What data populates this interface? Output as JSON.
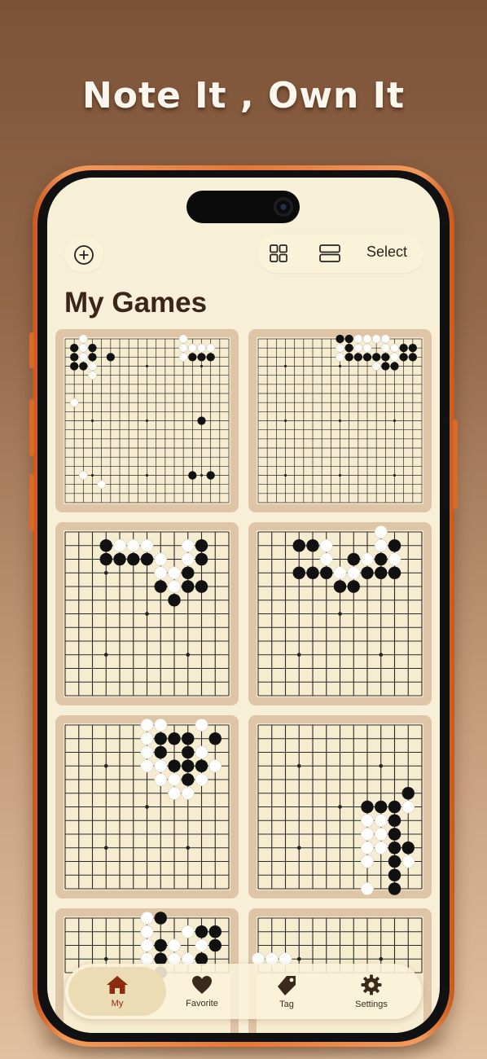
{
  "promo": {
    "headline": "Note It , Own It"
  },
  "header": {
    "add_icon": "plus-circle-icon",
    "grid_view_icon": "grid-view-icon",
    "list_view_icon": "list-view-icon",
    "select_label": "Select"
  },
  "page": {
    "title": "My Games"
  },
  "games": [
    {
      "size": 19,
      "view_rows": 19,
      "view_cols": 19,
      "col_offset": 0,
      "row_offset": 0,
      "hoshi": [
        [
          3,
          3
        ],
        [
          3,
          9
        ],
        [
          3,
          15
        ],
        [
          9,
          3
        ],
        [
          9,
          9
        ],
        [
          9,
          15
        ],
        [
          15,
          3
        ],
        [
          15,
          9
        ],
        [
          15,
          15
        ]
      ],
      "black": [
        [
          1,
          1
        ],
        [
          2,
          1
        ],
        [
          3,
          1
        ],
        [
          1,
          3
        ],
        [
          2,
          3
        ],
        [
          3,
          2
        ],
        [
          2,
          5
        ],
        [
          1,
          14
        ],
        [
          2,
          14
        ],
        [
          2,
          15
        ],
        [
          2,
          16
        ],
        [
          9,
          15
        ],
        [
          15,
          14
        ],
        [
          15,
          16
        ]
      ],
      "white": [
        [
          0,
          2
        ],
        [
          1,
          2
        ],
        [
          2,
          2
        ],
        [
          3,
          3
        ],
        [
          4,
          3
        ],
        [
          1,
          14
        ],
        [
          2,
          13
        ],
        [
          1,
          15
        ],
        [
          1,
          16
        ],
        [
          7,
          1
        ],
        [
          15,
          2
        ],
        [
          16,
          4
        ],
        [
          0,
          13
        ],
        [
          1,
          13
        ]
      ]
    },
    {
      "size": 19,
      "view_rows": 19,
      "view_cols": 19,
      "col_offset": 0,
      "row_offset": 0,
      "hoshi": [
        [
          3,
          3
        ],
        [
          3,
          9
        ],
        [
          3,
          15
        ],
        [
          9,
          3
        ],
        [
          9,
          9
        ],
        [
          9,
          15
        ],
        [
          15,
          3
        ],
        [
          15,
          9
        ],
        [
          15,
          15
        ]
      ],
      "black": [
        [
          0,
          9
        ],
        [
          0,
          10
        ],
        [
          1,
          10
        ],
        [
          2,
          10
        ],
        [
          2,
          11
        ],
        [
          2,
          12
        ],
        [
          2,
          13
        ],
        [
          2,
          14
        ],
        [
          3,
          14
        ],
        [
          3,
          15
        ],
        [
          1,
          16
        ],
        [
          2,
          16
        ],
        [
          2,
          17
        ],
        [
          1,
          17
        ]
      ],
      "white": [
        [
          0,
          11
        ],
        [
          0,
          12
        ],
        [
          0,
          13
        ],
        [
          0,
          14
        ],
        [
          1,
          11
        ],
        [
          1,
          12
        ],
        [
          1,
          14
        ],
        [
          1,
          15
        ],
        [
          2,
          15
        ],
        [
          3,
          13
        ],
        [
          2,
          9
        ],
        [
          1,
          9
        ]
      ]
    },
    {
      "size": 13,
      "view_rows": 13,
      "view_cols": 13,
      "col_offset": 0,
      "row_offset": 0,
      "hoshi": [
        [
          3,
          3
        ],
        [
          3,
          9
        ],
        [
          9,
          3
        ],
        [
          9,
          9
        ],
        [
          6,
          6
        ]
      ],
      "black": [
        [
          1,
          3
        ],
        [
          2,
          3
        ],
        [
          2,
          4
        ],
        [
          2,
          5
        ],
        [
          2,
          6
        ],
        [
          1,
          10
        ],
        [
          2,
          10
        ],
        [
          3,
          9
        ],
        [
          4,
          7
        ],
        [
          4,
          9
        ],
        [
          5,
          8
        ],
        [
          4,
          10
        ]
      ],
      "white": [
        [
          1,
          4
        ],
        [
          1,
          5
        ],
        [
          1,
          6
        ],
        [
          1,
          9
        ],
        [
          2,
          7
        ],
        [
          2,
          9
        ],
        [
          3,
          7
        ],
        [
          3,
          8
        ],
        [
          4,
          8
        ]
      ]
    },
    {
      "size": 13,
      "view_rows": 13,
      "view_cols": 13,
      "col_offset": 0,
      "row_offset": 0,
      "hoshi": [
        [
          3,
          3
        ],
        [
          3,
          9
        ],
        [
          9,
          3
        ],
        [
          9,
          9
        ],
        [
          6,
          6
        ]
      ],
      "black": [
        [
          1,
          3
        ],
        [
          1,
          4
        ],
        [
          3,
          3
        ],
        [
          3,
          4
        ],
        [
          3,
          5
        ],
        [
          3,
          8
        ],
        [
          3,
          9
        ],
        [
          3,
          10
        ],
        [
          2,
          7
        ],
        [
          2,
          9
        ],
        [
          1,
          10
        ],
        [
          4,
          6
        ],
        [
          4,
          7
        ]
      ],
      "white": [
        [
          1,
          5
        ],
        [
          2,
          5
        ],
        [
          3,
          6
        ],
        [
          2,
          8
        ],
        [
          3,
          7
        ],
        [
          1,
          9
        ],
        [
          0,
          9
        ],
        [
          2,
          10
        ]
      ]
    },
    {
      "size": 13,
      "view_rows": 13,
      "view_cols": 13,
      "col_offset": 0,
      "row_offset": 0,
      "hoshi": [
        [
          3,
          3
        ],
        [
          3,
          9
        ],
        [
          9,
          3
        ],
        [
          9,
          9
        ],
        [
          6,
          6
        ]
      ],
      "black": [
        [
          1,
          6
        ],
        [
          1,
          7
        ],
        [
          1,
          8
        ],
        [
          1,
          9
        ],
        [
          2,
          7
        ],
        [
          3,
          8
        ],
        [
          3,
          9
        ],
        [
          2,
          9
        ],
        [
          1,
          11
        ],
        [
          4,
          9
        ],
        [
          3,
          10
        ]
      ],
      "white": [
        [
          0,
          6
        ],
        [
          0,
          7
        ],
        [
          1,
          6
        ],
        [
          2,
          6
        ],
        [
          3,
          6
        ],
        [
          3,
          7
        ],
        [
          2,
          10
        ],
        [
          0,
          10
        ],
        [
          4,
          8
        ],
        [
          4,
          7
        ],
        [
          5,
          8
        ],
        [
          5,
          9
        ],
        [
          3,
          11
        ],
        [
          4,
          10
        ],
        [
          5,
          8
        ]
      ]
    },
    {
      "size": 13,
      "view_rows": 13,
      "view_cols": 13,
      "col_offset": 0,
      "row_offset": 0,
      "hoshi": [
        [
          3,
          3
        ],
        [
          3,
          9
        ],
        [
          9,
          3
        ],
        [
          9,
          9
        ],
        [
          6,
          6
        ]
      ],
      "black": [
        [
          5,
          11
        ],
        [
          6,
          8
        ],
        [
          6,
          9
        ],
        [
          6,
          10
        ],
        [
          7,
          10
        ],
        [
          8,
          10
        ],
        [
          9,
          10
        ],
        [
          10,
          10
        ],
        [
          11,
          10
        ],
        [
          12,
          10
        ],
        [
          9,
          11
        ]
      ],
      "white": [
        [
          6,
          11
        ],
        [
          7,
          8
        ],
        [
          7,
          9
        ],
        [
          8,
          8
        ],
        [
          9,
          8
        ],
        [
          10,
          8
        ],
        [
          8,
          9
        ],
        [
          10,
          11
        ],
        [
          12,
          8
        ],
        [
          9,
          9
        ]
      ]
    },
    {
      "size": 19,
      "view_rows": 5,
      "view_cols": 13,
      "col_offset": 0,
      "row_offset": 0,
      "hoshi": [
        [
          3,
          3
        ],
        [
          3,
          9
        ]
      ],
      "black": [
        [
          0,
          7
        ],
        [
          2,
          7
        ],
        [
          1,
          10
        ],
        [
          1,
          11
        ],
        [
          2,
          11
        ],
        [
          3,
          7
        ],
        [
          3,
          10
        ],
        [
          4,
          7
        ]
      ],
      "white": [
        [
          1,
          6
        ],
        [
          2,
          6
        ],
        [
          2,
          8
        ],
        [
          3,
          6
        ],
        [
          1,
          9
        ],
        [
          2,
          10
        ],
        [
          3,
          9
        ],
        [
          0,
          6
        ],
        [
          3,
          8
        ]
      ]
    },
    {
      "size": 19,
      "view_rows": 5,
      "view_cols": 13,
      "col_offset": 0,
      "row_offset": 0,
      "hoshi": [
        [
          3,
          3
        ],
        [
          3,
          9
        ]
      ],
      "black": [],
      "white": [
        [
          3,
          0
        ],
        [
          3,
          1
        ],
        [
          3,
          2
        ]
      ]
    }
  ],
  "tabbar": {
    "items": [
      {
        "label": "My",
        "icon": "home-icon"
      },
      {
        "label": "Favorite",
        "icon": "heart-icon"
      },
      {
        "label": "Tag",
        "icon": "tag-icon"
      },
      {
        "label": "Settings",
        "icon": "gear-icon"
      }
    ],
    "active_index": 0,
    "active_color": "#8a2b12"
  },
  "colors": {
    "card_bg": "#dec5a5",
    "screen_bg": "#f8efd8",
    "frame": "#e7772f"
  }
}
